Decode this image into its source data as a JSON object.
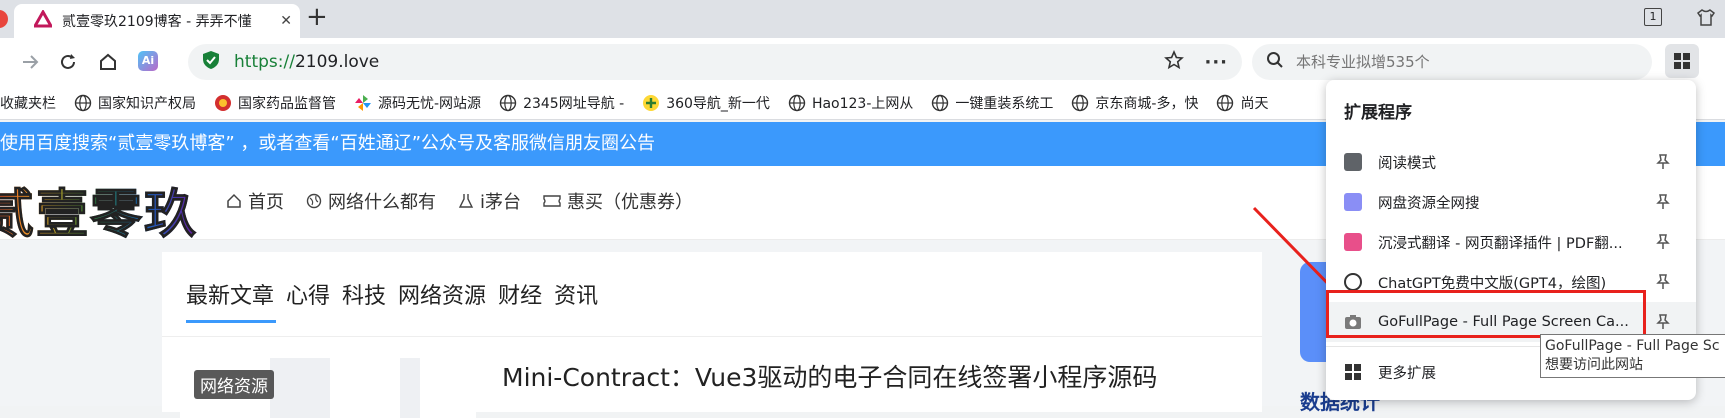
{
  "tab": {
    "title": "贰壹零玖2109博客 - 弄弄不懂",
    "close": "✕",
    "new_tab": "+"
  },
  "window": {
    "collections_count": "1"
  },
  "address": {
    "scheme": "https://",
    "host": "2109.love"
  },
  "search": {
    "placeholder": "本科专业拟增535个"
  },
  "bookmarks": [
    {
      "label": "收藏夹栏",
      "icon": "folder-icon"
    },
    {
      "label": "国家知识产权局",
      "icon": "globe-icon"
    },
    {
      "label": "国家药品监督管",
      "icon": "emblem-icon"
    },
    {
      "label": "源码无忧-网站源",
      "icon": "pinwheel-icon"
    },
    {
      "label": "2345网址导航 -",
      "icon": "globe-icon"
    },
    {
      "label": "360导航_新一代",
      "icon": "360-icon"
    },
    {
      "label": "Hao123-上网从",
      "icon": "globe-icon"
    },
    {
      "label": "一键重装系统工",
      "icon": "globe-icon"
    },
    {
      "label": "京东商城-多，快",
      "icon": "globe-icon"
    },
    {
      "label": "尚天",
      "icon": "globe-icon"
    }
  ],
  "notice": "使用百度搜索“贰壹零玖博客” ，或者查看“百姓通辽”公众号及客服微信朋友圈公告",
  "site": {
    "logo": "贰壹零玖",
    "nav": [
      "首页",
      "网络什么都有",
      "i茅台",
      "惠买（优惠券）"
    ]
  },
  "content": {
    "categories": [
      "最新文章",
      "心得",
      "科技",
      "网络资源",
      "财经",
      "资讯"
    ],
    "thumb_badge": "网络资源",
    "post_title": "Mini-Contract：Vue3驱动的电子合同在线签署小程序源码",
    "sidebar_title": "数据统计"
  },
  "extensions": {
    "heading": "扩展程序",
    "items": [
      {
        "label": "阅读模式",
        "color": "#5f6368"
      },
      {
        "label": "网盘资源全网搜",
        "color": "#8a8ef5"
      },
      {
        "label": "沉浸式翻译 - 网页翻译插件 | PDF翻...",
        "color": "#e84f8a"
      },
      {
        "label": "ChatGPT免费中文版(GPT4，绘图)",
        "color": "#333333"
      },
      {
        "label": "GoFullPage - Full Page Screen Ca...",
        "color": "#7a7a7a"
      }
    ],
    "more": "更多扩展"
  },
  "tooltip": {
    "line1": "GoFullPage - Full Page Sc",
    "line2": "想要访问此网站"
  },
  "colors": {
    "accent": "#3b99fc",
    "highlight": "#e8211c",
    "secure": "#188038"
  }
}
